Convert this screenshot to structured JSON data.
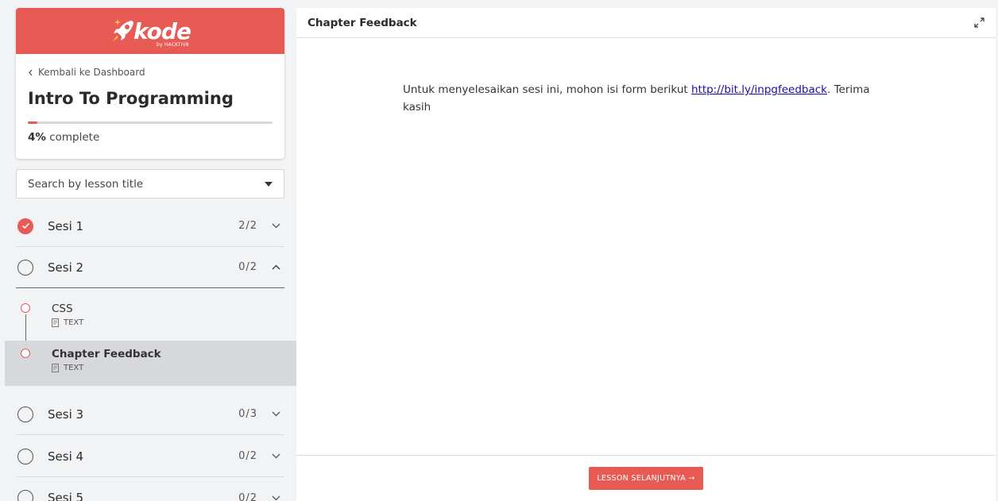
{
  "brand": {
    "name": "kode",
    "sub": "by HACKTIV8",
    "color": "#e85a54"
  },
  "course": {
    "back_label": "Kembali ke Dashboard",
    "title": "Intro To Programming",
    "progress_percent": 4,
    "progress_value": "4%",
    "progress_suffix": " complete"
  },
  "search": {
    "placeholder": "Search by lesson title"
  },
  "sessions": [
    {
      "name": "Sesi 1",
      "count": "2/2",
      "done": true,
      "expanded": false
    },
    {
      "name": "Sesi 2",
      "count": "0/2",
      "done": false,
      "expanded": true
    },
    {
      "name": "Sesi 3",
      "count": "0/3",
      "done": false,
      "expanded": false
    },
    {
      "name": "Sesi 4",
      "count": "0/2",
      "done": false,
      "expanded": false
    },
    {
      "name": "Sesi 5",
      "count": "0/2",
      "done": false,
      "expanded": false
    }
  ],
  "lessons": [
    {
      "name": "CSS",
      "type": "TEXT"
    },
    {
      "name": "Chapter Feedback",
      "type": "TEXT",
      "active": true
    }
  ],
  "main": {
    "title": "Chapter Feedback",
    "body_prefix": "Untuk menyelesaikan sesi ini, mohon isi form berikut ",
    "link": "http://bit.ly/inpgfeedback",
    "body_suffix": ". Terima kasih",
    "next_label": "LESSON SELANJUTNYA →"
  }
}
